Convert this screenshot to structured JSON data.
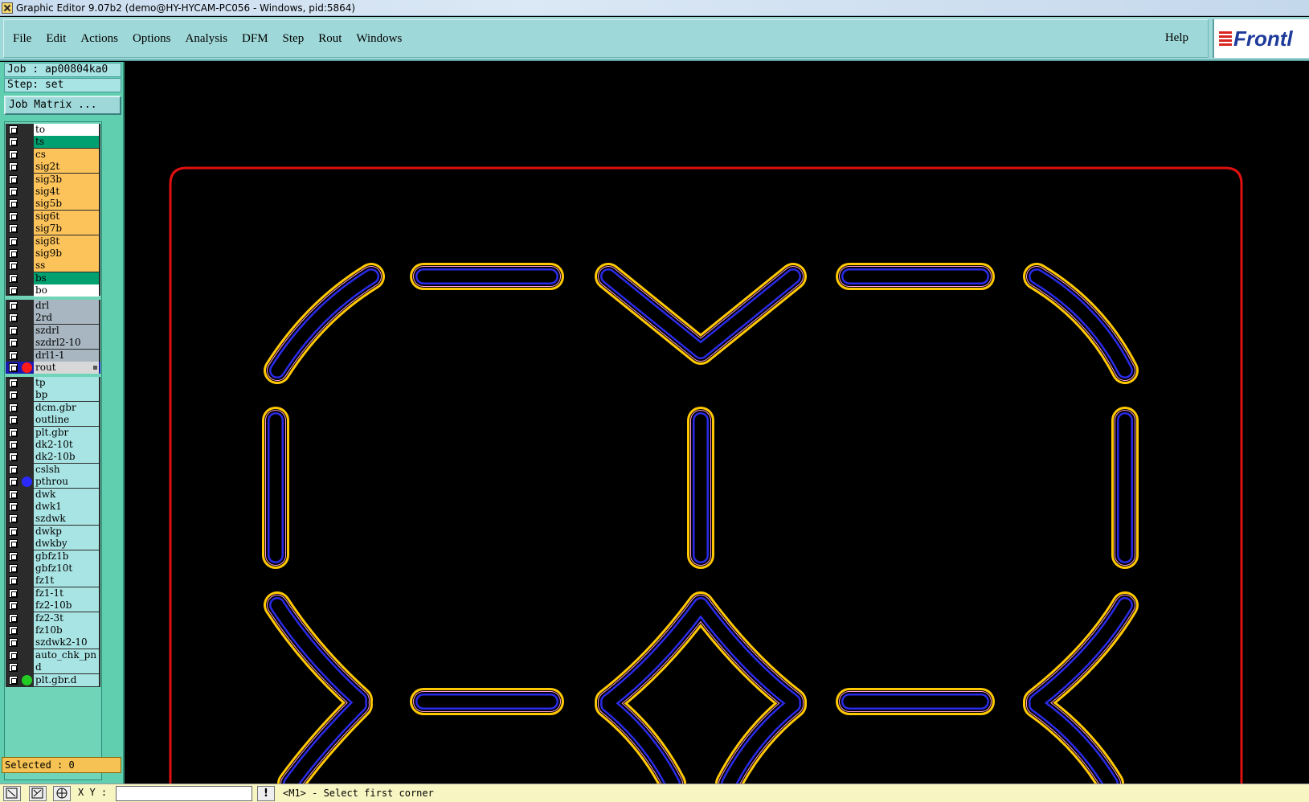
{
  "window": {
    "title": "Graphic Editor 9.07b2 (demo@HY-HYCAM-PC056 - Windows, pid:5864)"
  },
  "menu": {
    "items": [
      "File",
      "Edit",
      "Actions",
      "Options",
      "Analysis",
      "DFM",
      "Step",
      "Rout",
      "Windows"
    ],
    "help": "Help",
    "logo_text": "Frontl"
  },
  "panel": {
    "job": "Job : ap00804ka0",
    "step": "Step: set",
    "job_matrix": "Job Matrix ...",
    "selected": "Selected : 0"
  },
  "layers": {
    "board": [
      {
        "name": "to",
        "color": "#ffffff"
      },
      {
        "name": "ts",
        "color": "#00a070"
      },
      {
        "name": "cs",
        "color": "#fcc35a"
      },
      {
        "name": "sig2t",
        "color": "#fcc35a"
      },
      {
        "name": "sig3b",
        "color": "#fcc35a"
      },
      {
        "name": "sig4t",
        "color": "#fcc35a"
      },
      {
        "name": "sig5b",
        "color": "#fcc35a"
      },
      {
        "name": "sig6t",
        "color": "#fcc35a"
      },
      {
        "name": "sig7b",
        "color": "#fcc35a"
      },
      {
        "name": "sig8t",
        "color": "#fcc35a"
      },
      {
        "name": "sig9b",
        "color": "#fcc35a"
      },
      {
        "name": "ss",
        "color": "#fcc35a"
      },
      {
        "name": "bs",
        "color": "#00a070"
      },
      {
        "name": "bo",
        "color": "#ffffff"
      }
    ],
    "drill": [
      {
        "name": "drl",
        "color": "#a7b6c0"
      },
      {
        "name": "2rd",
        "color": "#a7b6c0"
      },
      {
        "name": "szdrl",
        "color": "#a7b6c0"
      },
      {
        "name": "szdrl2-10",
        "color": "#a7b6c0"
      },
      {
        "name": "drl1-1",
        "color": "#a7b6c0"
      },
      {
        "name": "rout",
        "color": "#d8d8d8",
        "active": true,
        "dot": "#ff1a1a"
      }
    ],
    "misc": [
      {
        "name": "tp",
        "color": "#a9e4e4"
      },
      {
        "name": "bp",
        "color": "#a9e4e4"
      },
      {
        "name": "dcm.gbr",
        "color": "#a9e4e4"
      },
      {
        "name": "outline",
        "color": "#a9e4e4"
      },
      {
        "name": "plt.gbr",
        "color": "#a9e4e4"
      },
      {
        "name": "dk2-10t",
        "color": "#a9e4e4"
      },
      {
        "name": "dk2-10b",
        "color": "#a9e4e4"
      },
      {
        "name": "cslsh",
        "color": "#a9e4e4"
      },
      {
        "name": "pthrou",
        "color": "#a9e4e4",
        "dot": "#2a2aff"
      },
      {
        "name": "dwk",
        "color": "#a9e4e4"
      },
      {
        "name": "dwk1",
        "color": "#a9e4e4"
      },
      {
        "name": "szdwk",
        "color": "#a9e4e4"
      },
      {
        "name": "dwkp",
        "color": "#a9e4e4"
      },
      {
        "name": "dwkby",
        "color": "#a9e4e4"
      },
      {
        "name": "gbfz1b",
        "color": "#a9e4e4"
      },
      {
        "name": "gbfz10t",
        "color": "#a9e4e4"
      },
      {
        "name": "fz1t",
        "color": "#a9e4e4"
      },
      {
        "name": "fz1-1t",
        "color": "#a9e4e4"
      },
      {
        "name": "fz2-10b",
        "color": "#a9e4e4"
      },
      {
        "name": "fz2-3t",
        "color": "#a9e4e4"
      },
      {
        "name": "fz10b",
        "color": "#a9e4e4"
      },
      {
        "name": "szdwk2-10",
        "color": "#a9e4e4"
      },
      {
        "name": "auto_chk_pn",
        "color": "#a9e4e4"
      },
      {
        "name": "d",
        "color": "#a9e4e4"
      },
      {
        "name": "plt.gbr.d",
        "color": "#a9e4e4",
        "dot": "#22cc22"
      }
    ]
  },
  "status": {
    "xy_label": "X Y :",
    "xy_value": "",
    "prompt": "<M1> - Select first corner"
  },
  "colors": {
    "outline_red": "#e01010",
    "rout_yellow": "#ffc800",
    "pthrou_blue": "#2a2ae8",
    "pink": "#ff9ad8",
    "panel_teal": "#5fcfb0",
    "menu_cyan": "#9fd8d8"
  },
  "icons": [
    "app-icon",
    "zoom-box-icon",
    "zoom-fit-icon",
    "grid-icon",
    "warning-icon",
    "frontline-logo"
  ]
}
